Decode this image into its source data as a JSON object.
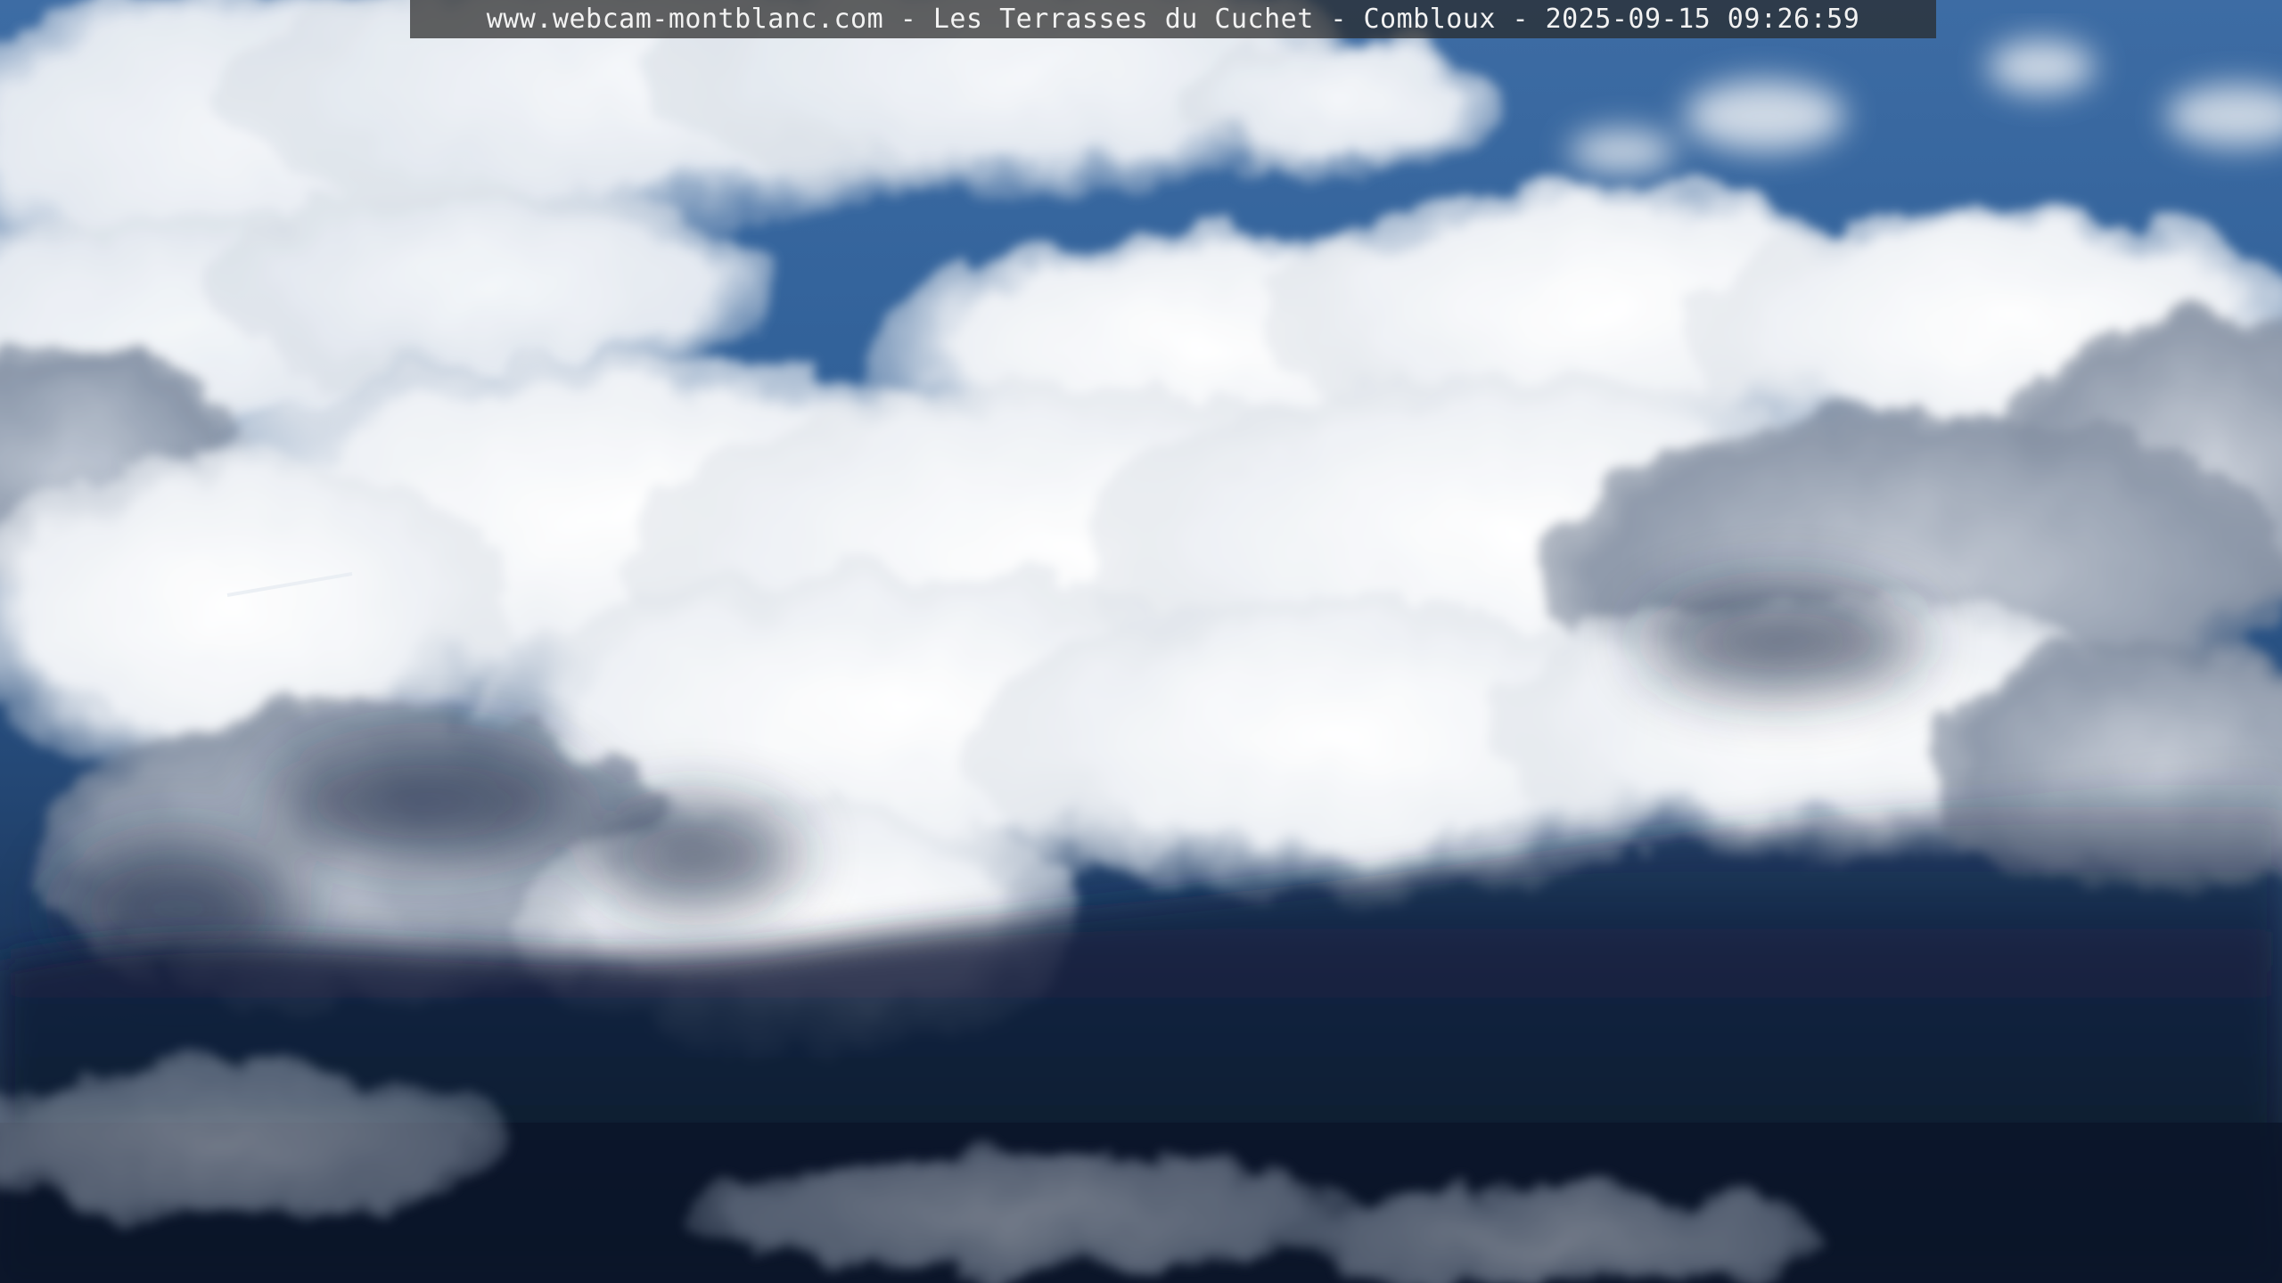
{
  "webcam": {
    "caption": "www.webcam-montblanc.com - Les Terrasses du Cuchet - Combloux - 2025-09-15 09:26:59"
  },
  "scene": {
    "description_icon": "cloudy-sky-image",
    "colors": {
      "sky_blue": "#3f6fa6",
      "sky_deep": "#2a5a93",
      "cloud_white": "#f4f6f8",
      "cloud_grey": "#b9c1cc",
      "storm_dark": "#0e1a30"
    }
  }
}
